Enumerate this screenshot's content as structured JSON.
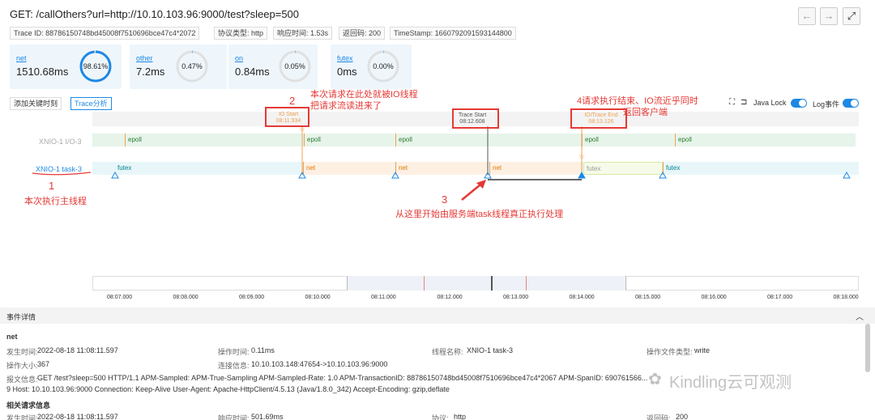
{
  "header": {
    "title": "GET: /callOthers?url=http://10.10.103.96:9000/test?sleep=500",
    "back_icon": "←",
    "forward_icon": "→",
    "fullscreen_icon": "⤢"
  },
  "tags": [
    "Trace ID: 88786150748bd45008f7510696bce47c4*2072",
    "协议类型: http",
    "响应时间: 1.53s",
    "返回码: 200",
    "TimeStamp: 1660792091593144800"
  ],
  "cards": [
    {
      "name": "net",
      "ms": "1510.68ms",
      "pct": "98.61%",
      "value": 0.9861
    },
    {
      "name": "other",
      "ms": "7.2ms",
      "pct": "0.47%",
      "value": 0.0047
    },
    {
      "name": "on",
      "ms": "0.84ms",
      "pct": "0.05%",
      "value": 0.0005
    },
    {
      "name": "futex",
      "ms": "0ms",
      "pct": "0.00%",
      "value": 0.0
    }
  ],
  "toolbar": {
    "add_key_time": "添加关键时刻",
    "trace_analysis": "Trace分析",
    "java_lock": "Java Lock",
    "log_event": "Log事件"
  },
  "rows": {
    "io_label": "XNIO-1 I/O-3",
    "task_label": "XNIO-1 task-3",
    "io_segments": [
      "epoll",
      "epoll",
      "epoll",
      "epoll",
      "epoll"
    ],
    "task_segments": [
      "futex",
      "net",
      "net",
      "net",
      "futex",
      "futex"
    ]
  },
  "markers": {
    "io_start_line1": "IO Start",
    "io_start_line2": "08:11.934",
    "trace_start_line1": "Trace Start",
    "trace_start_line2": "08:12.608",
    "trace_end_line1": "IO/Trace End",
    "trace_end_line2": "08:13.126"
  },
  "annotations": {
    "n1": "1",
    "n1_text": "本次执行主线程",
    "n2": "2",
    "n2_text_l1": "本次请求在此处就被IO线程",
    "n2_text_l2": "把请求流读进来了",
    "n3": "3",
    "n3_text": "从这里开始由服务端task线程真正执行处理",
    "n4_text_l1": "4请求执行结束、IO流近乎同时",
    "n4_text_l2": "返回客户端"
  },
  "axis_ticks": [
    "08:07.000",
    "08:08.000",
    "08:09.000",
    "08:10.000",
    "08:11.000",
    "08:12.000",
    "08:13.000",
    "08:14.000",
    "08:15.000",
    "08:16.000",
    "08:17.000",
    "08:18.000"
  ],
  "details": {
    "section_title": "事件详情",
    "event_name": "net",
    "occur_time_label": "发生时间:",
    "occur_time": "2022-08-18 11:08:11.597",
    "op_time_label": "操作时间:",
    "op_time": "0.11ms",
    "thread_label": "线程名称:",
    "thread": "XNIO-1 task-3",
    "file_type_label": "操作文件类型:",
    "file_type": "write",
    "op_size_label": "操作大小:",
    "op_size": "367",
    "conn_label": "连接信息:",
    "conn": "10.10.103.148:47654->10.10.103.96:9000",
    "msg_label": "报文信息:",
    "msg_l1": "GET /test?sleep=500 HTTP/1.1 APM-Sampled: APM-True-Sampling APM-Sampled-Rate: 1.0 APM-TransactionID: 88786150748bd45008f7510696bce47c4*2067 APM-SpanID: 690761566...",
    "msg_l2": "9 Host: 10.10.103.96:9000 Connection: Keep-Alive User-Agent: Apache-HttpClient/4.5.13 (Java/1.8.0_342) Accept-Encoding: gzip,deflate",
    "related_title": "相关请求信息",
    "r_time": "2022-08-18 11:08:11.597",
    "r_resp": "501.69ms",
    "r_proto": "http",
    "r_code": "200",
    "r_resp_label": "响应时间:",
    "r_proto_label": "协议:",
    "r_code_label": "返回码:"
  },
  "watermark": "Kindling云可观测",
  "colors": {
    "accent": "#1e88e5",
    "annotation": "#e53935",
    "io_bar": "#e6f4ea",
    "net_bar": "#fdf0e3",
    "futex_bar": "#e8f6f9"
  }
}
